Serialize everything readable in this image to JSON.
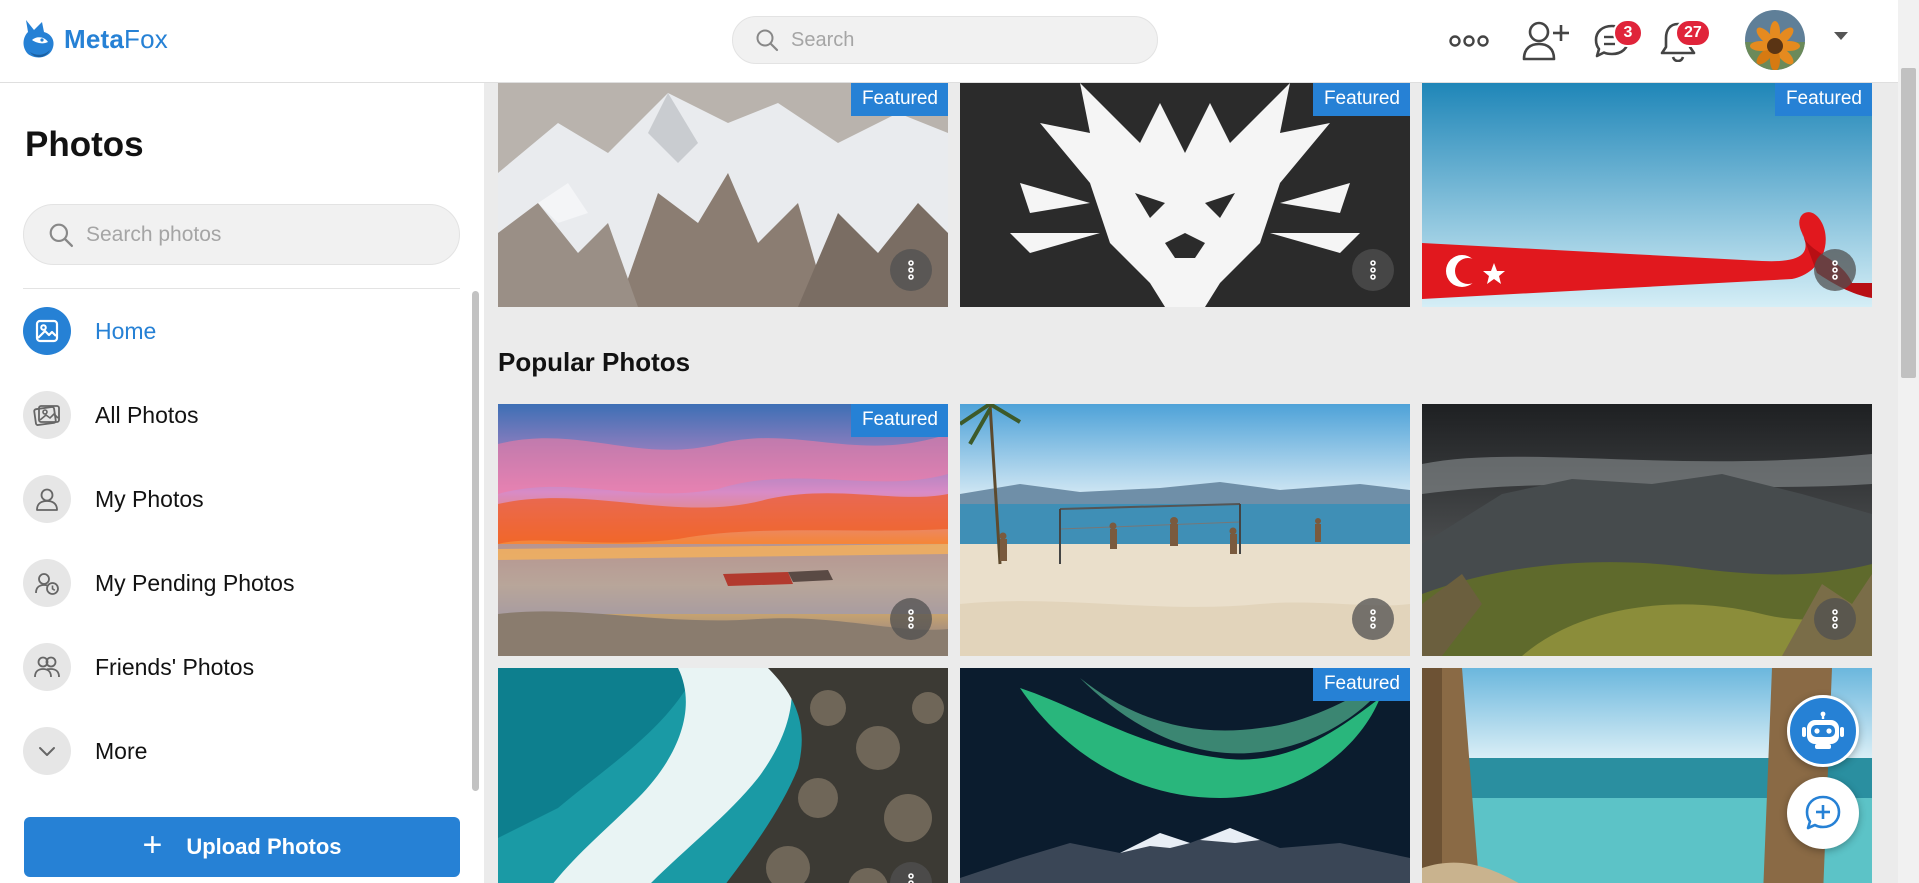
{
  "header": {
    "logo_meta": "Meta",
    "logo_fox": "Fox",
    "search_placeholder": "Search",
    "messages_count": "3",
    "notifications_count": "27"
  },
  "sidebar": {
    "title": "Photos",
    "search_placeholder": "Search photos",
    "items": [
      {
        "label": "Home",
        "icon": "image-icon",
        "active": true
      },
      {
        "label": "All Photos",
        "icon": "photos-icon"
      },
      {
        "label": "My Photos",
        "icon": "user-icon"
      },
      {
        "label": "My Pending Photos",
        "icon": "pending-icon"
      },
      {
        "label": "Friends' Photos",
        "icon": "friends-icon"
      },
      {
        "label": "More",
        "icon": "chevron-down-icon"
      }
    ],
    "upload_label": "Upload Photos"
  },
  "main": {
    "featured_badge": "Featured",
    "popular_title": "Popular Photos",
    "top_row": [
      {
        "subject": "snowy mountains",
        "featured": true
      },
      {
        "subject": "lion emblem",
        "featured": true
      },
      {
        "subject": "turkish flag ribbon",
        "featured": true
      }
    ],
    "popular_row1": [
      {
        "subject": "sunset over lake",
        "featured": true
      },
      {
        "subject": "beach volleyball",
        "featured": false
      },
      {
        "subject": "mountain valley",
        "featured": false
      }
    ],
    "popular_row2": [
      {
        "subject": "ocean waves on rocks",
        "featured": false
      },
      {
        "subject": "northern lights",
        "featured": true
      },
      {
        "subject": "beach boardwalk",
        "featured": false
      }
    ]
  },
  "colors": {
    "accent": "#2681d5",
    "badge": "#e0243a"
  }
}
